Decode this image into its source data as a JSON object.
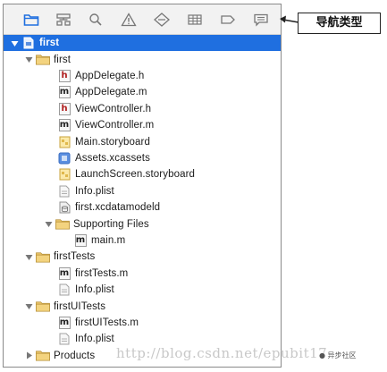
{
  "toolbar": {
    "icons": [
      "project-navigator-icon",
      "symbol-navigator-icon",
      "find-navigator-icon",
      "issue-navigator-icon",
      "test-navigator-icon",
      "debug-navigator-icon",
      "breakpoint-navigator-icon",
      "report-navigator-icon"
    ]
  },
  "callout": {
    "label": "导航类型"
  },
  "tree": {
    "project": "first",
    "group_first": "first",
    "app_delegate_h": "AppDelegate.h",
    "app_delegate_m": "AppDelegate.m",
    "view_controller_h": "ViewController.h",
    "view_controller_m": "ViewController.m",
    "main_storyboard": "Main.storyboard",
    "assets": "Assets.xcassets",
    "launch_screen": "LaunchScreen.storyboard",
    "info_plist": "Info.plist",
    "datamodel": "first.xcdatamodeld",
    "supporting_files": "Supporting Files",
    "main_m": "main.m",
    "group_tests": "firstTests",
    "tests_m": "firstTests.m",
    "tests_info_plist": "Info.plist",
    "group_uitests": "firstUITests",
    "uitests_m": "firstUITests.m",
    "uitests_info_plist": "Info.plist",
    "products": "Products"
  },
  "file_badges": {
    "header": "h",
    "implementation": "m"
  },
  "watermark": "http://blog.csdn.net/epubit17",
  "colors": {
    "selection": "#1f6fe0",
    "folder": "#e9c46a",
    "accent_toolbar": "#1f6fe0"
  }
}
